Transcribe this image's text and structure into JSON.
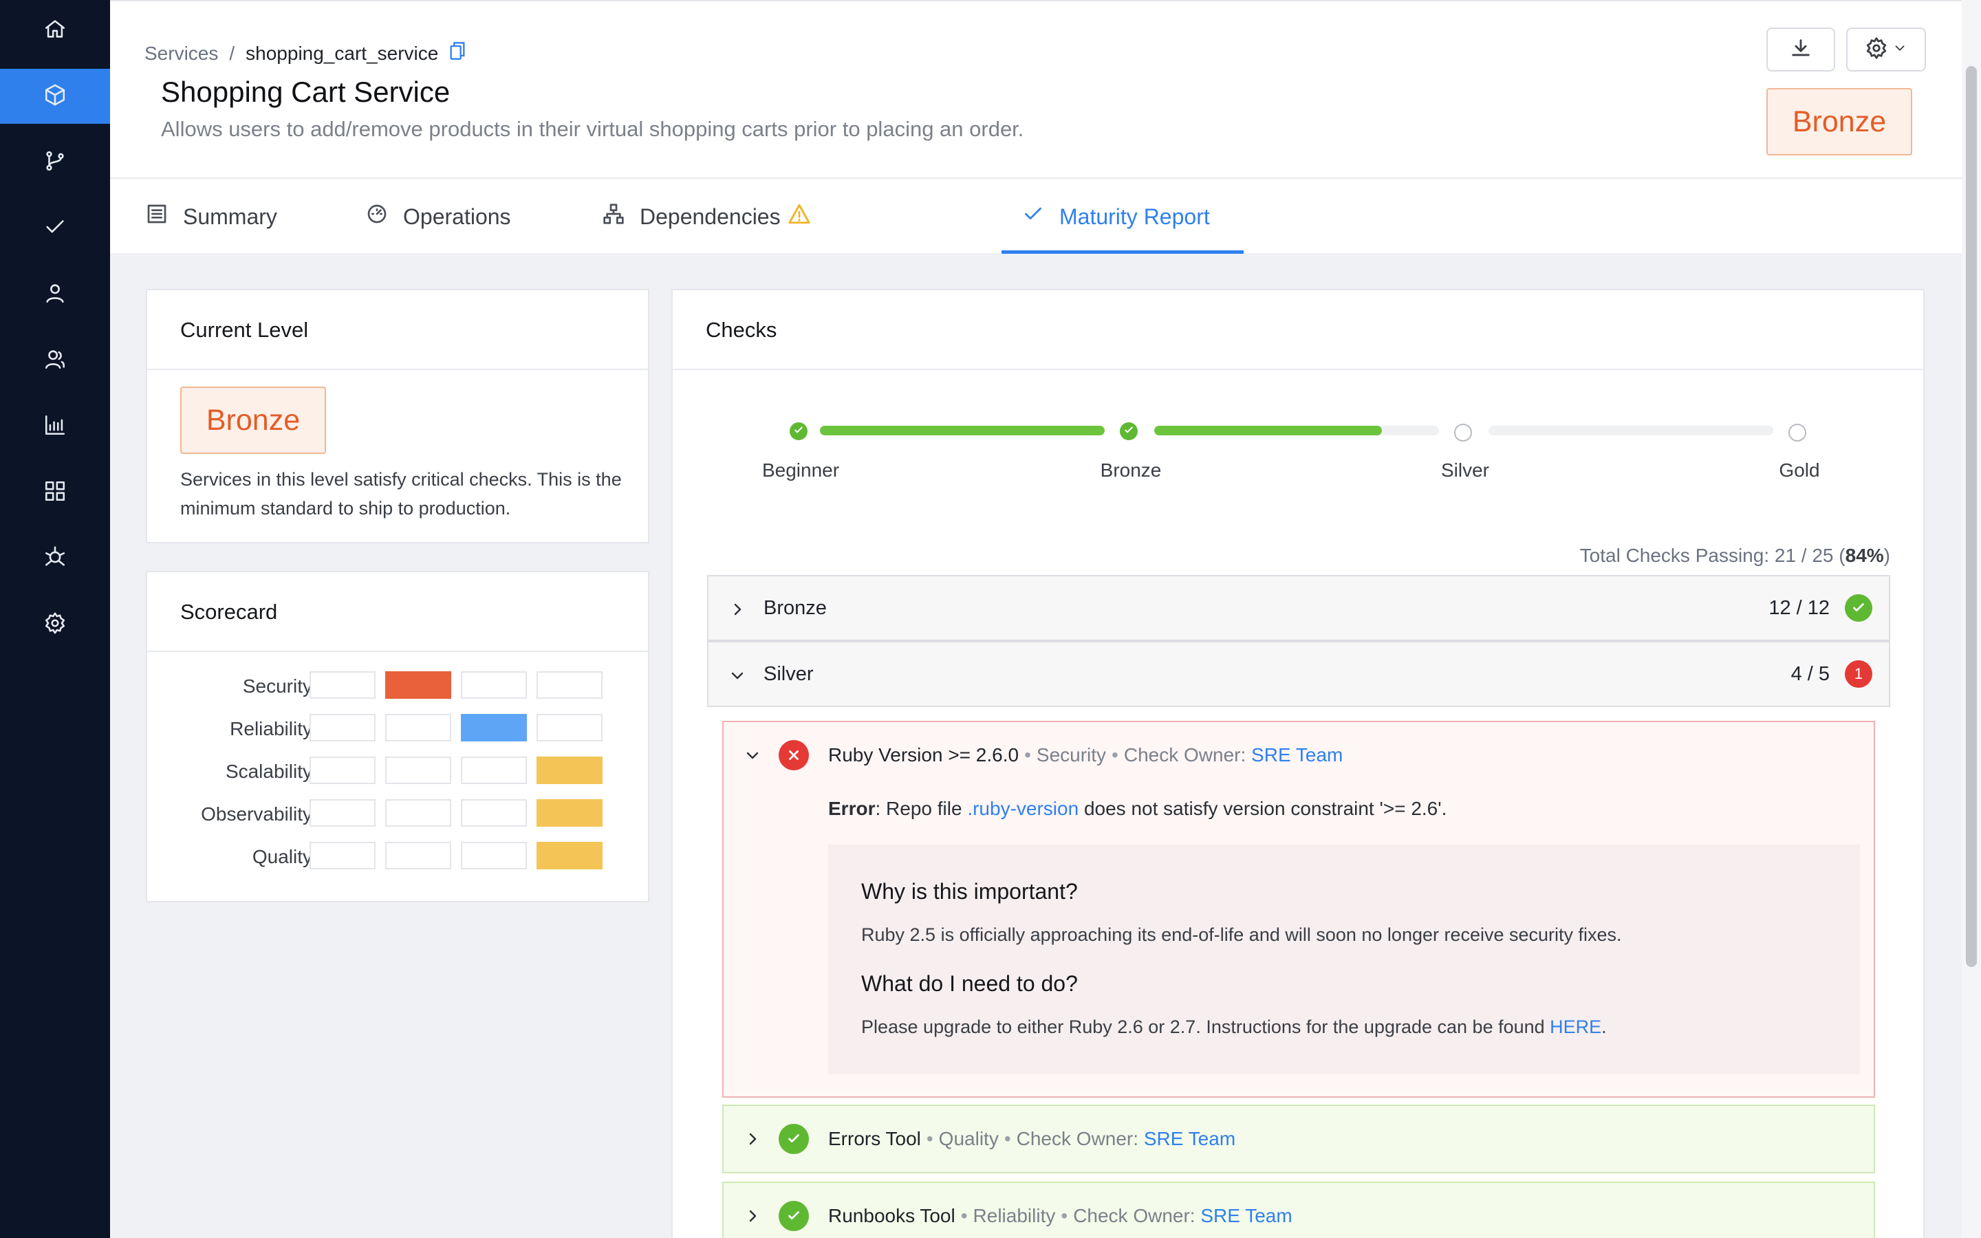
{
  "sidebar": {
    "items": [
      {
        "name": "home-icon"
      },
      {
        "name": "cube-icon",
        "active": true
      },
      {
        "name": "git-branch-icon"
      },
      {
        "name": "check-icon"
      },
      {
        "name": "user-icon"
      },
      {
        "name": "users-icon"
      },
      {
        "name": "chart-icon"
      },
      {
        "name": "grid-icon"
      },
      {
        "name": "network-icon"
      },
      {
        "name": "gear-icon"
      }
    ]
  },
  "header": {
    "breadcrumb": {
      "parent": "Services",
      "separator": "/",
      "current": "shopping_cart_service"
    },
    "title": "Shopping Cart Service",
    "description": "Allows users to add/remove products in their virtual shopping carts prior to placing an order.",
    "level_badge": "Bronze"
  },
  "tabs": [
    {
      "label": "Summary",
      "icon": "list-icon"
    },
    {
      "label": "Operations",
      "icon": "gauge-icon"
    },
    {
      "label": "Dependencies",
      "icon": "hierarchy-icon",
      "warning": true
    },
    {
      "label": "Maturity Report",
      "icon": "check-icon",
      "active": true
    }
  ],
  "current_level": {
    "title": "Current Level",
    "badge": "Bronze",
    "description": "Services in this level satisfy critical checks. This is the minimum standard to ship to production."
  },
  "scorecard": {
    "title": "Scorecard",
    "rows": [
      {
        "label": "Security",
        "level": 2,
        "color": "#e8613a"
      },
      {
        "label": "Reliability",
        "level": 3,
        "color": "#5ea5f5"
      },
      {
        "label": "Scalability",
        "level": 4,
        "color": "#f4c556"
      },
      {
        "label": "Observability",
        "level": 4,
        "color": "#f4c556"
      },
      {
        "label": "Quality",
        "level": 4,
        "color": "#f4c556"
      }
    ]
  },
  "checks": {
    "title": "Checks",
    "levels": [
      {
        "label": "Beginner",
        "done": true,
        "progress_to_next": 1.0
      },
      {
        "label": "Bronze",
        "done": true,
        "progress_to_next": 0.8
      },
      {
        "label": "Silver",
        "done": false,
        "progress_to_next": 0.0
      },
      {
        "label": "Gold",
        "done": false
      }
    ],
    "total": {
      "prefix": "Total Checks Passing: 21 / 25 (",
      "percent": "84%",
      "suffix": ")"
    },
    "groups": [
      {
        "name": "Bronze",
        "count": "12 / 12",
        "status": "pass"
      },
      {
        "name": "Silver",
        "count": "4 / 5",
        "status": "fail",
        "fail_count": "1"
      }
    ],
    "failed_check": {
      "name": "Ruby Version >= 2.6.0",
      "category": "Security",
      "owner_label": "Check Owner:",
      "owner": "SRE Team",
      "error_label": "Error",
      "error_pre": ": Repo file ",
      "error_file": ".ruby-version",
      "error_post": " does not satisfy version constraint '>= 2.6'.",
      "why_title": "Why is this important?",
      "why_text": "Ruby 2.5 is officially approaching its end-of-life and will soon no longer receive security fixes.",
      "todo_title": "What do I need to do?",
      "todo_text": "Please upgrade to either Ruby 2.6 or 2.7. Instructions for the upgrade can be found ",
      "todo_link": "HERE",
      "todo_end": "."
    },
    "passed_checks": [
      {
        "name": "Errors Tool",
        "category": "Quality",
        "owner_label": "Check Owner:",
        "owner": "SRE Team"
      },
      {
        "name": "Runbooks Tool",
        "category": "Reliability",
        "owner_label": "Check Owner:",
        "owner": "SRE Team"
      }
    ]
  }
}
